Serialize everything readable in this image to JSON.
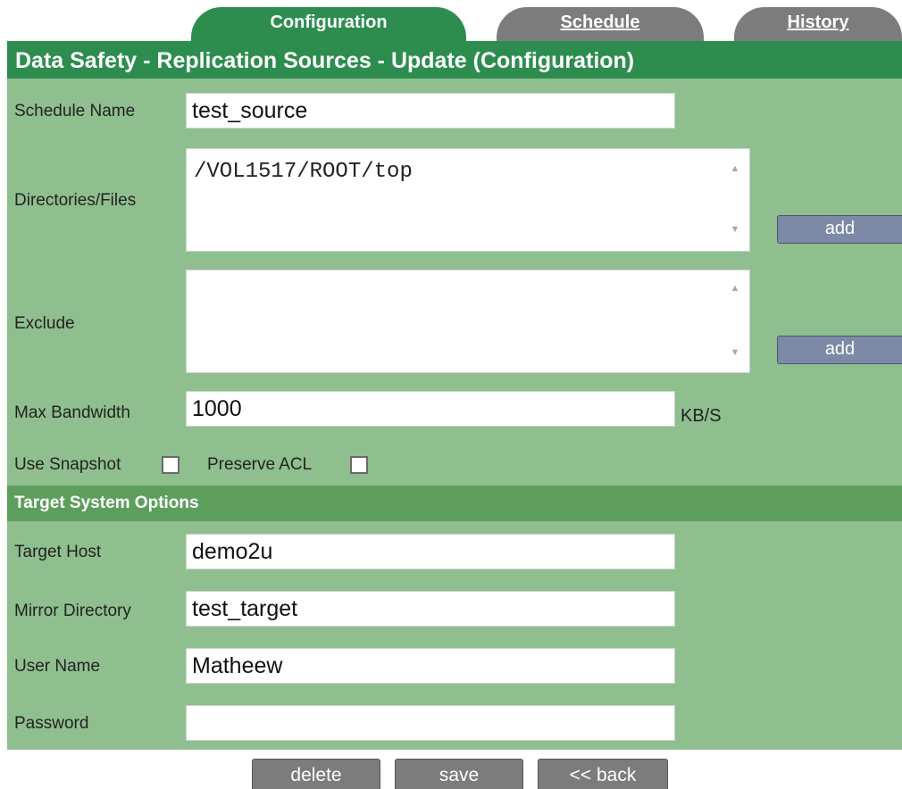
{
  "tabs": [
    {
      "label": "Configuration",
      "active": true
    },
    {
      "label": "Schedule",
      "active": false
    },
    {
      "label": "History",
      "active": false
    }
  ],
  "title": "Data Safety - Replication Sources - Update (Configuration)",
  "form": {
    "schedule_name": {
      "label": "Schedule Name",
      "value": "test_source"
    },
    "directories": {
      "label": "Directories/Files",
      "value": "/VOL1517/ROOT/top",
      "add_label": "add"
    },
    "exclude": {
      "label": "Exclude",
      "value": "",
      "add_label": "add"
    },
    "max_bandwidth": {
      "label": "Max Bandwidth",
      "value": "1000",
      "unit": "KB/S"
    },
    "use_snapshot": {
      "label": "Use Snapshot",
      "checked": false
    },
    "preserve_acl": {
      "label": "Preserve ACL",
      "checked": false
    }
  },
  "target": {
    "section_title": "Target System Options",
    "host": {
      "label": "Target Host",
      "value": "demo2u"
    },
    "mirror_directory": {
      "label": "Mirror Directory",
      "value": "test_target"
    },
    "user_name": {
      "label": "User Name",
      "value": "Matheew"
    },
    "password": {
      "label": "Password",
      "value": ""
    }
  },
  "buttons": {
    "delete": "delete",
    "save": "save",
    "back": "<< back"
  },
  "icons": {
    "scroll_up": "scroll-up-arrow-icon",
    "scroll_down": "scroll-down-arrow-icon"
  },
  "colors": {
    "header": "#2c8d4e",
    "form_bg": "#8fbf8f",
    "section": "#5d9e5d",
    "tab_inactive": "#7c7c7c",
    "add_button": "#7c8aa8"
  }
}
